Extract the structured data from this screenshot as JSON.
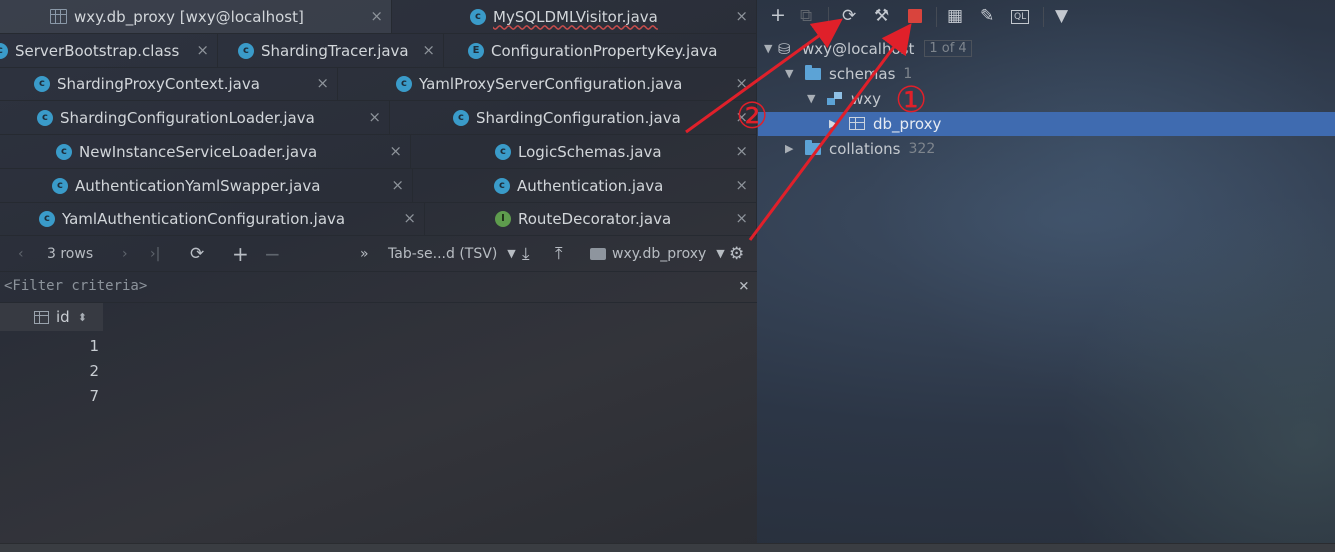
{
  "editor_tabs": {
    "rows": [
      [
        {
          "label": "wxy.db_proxy [wxy@localhost]",
          "icon": "table",
          "active": true
        },
        {
          "label": "MySQLDMLVisitor.java",
          "icon": "class",
          "squiggle": true
        }
      ],
      [
        {
          "label": "ServerBootstrap.class",
          "icon": "class"
        },
        {
          "label": "ShardingTracer.java",
          "icon": "class"
        },
        {
          "label": "ConfigurationPropertyKey.java",
          "icon": "enum"
        }
      ],
      [
        {
          "label": "ShardingProxyContext.java",
          "icon": "class"
        },
        {
          "label": "YamlProxyServerConfiguration.java",
          "icon": "class"
        }
      ],
      [
        {
          "label": "ShardingConfigurationLoader.java",
          "icon": "class"
        },
        {
          "label": "ShardingConfiguration.java",
          "icon": "class"
        }
      ],
      [
        {
          "label": "NewInstanceServiceLoader.java",
          "icon": "class"
        },
        {
          "label": "LogicSchemas.java",
          "icon": "class"
        }
      ],
      [
        {
          "label": "AuthenticationYamlSwapper.java",
          "icon": "class"
        },
        {
          "label": "Authentication.java",
          "icon": "class"
        }
      ],
      [
        {
          "label": "YamlAuthenticationConfiguration.java",
          "icon": "class"
        },
        {
          "label": "RouteDecorator.java",
          "icon": "interface"
        }
      ]
    ],
    "close_glyph": "×"
  },
  "result_toolbar": {
    "rows_label": "3 rows",
    "more_glyph": "»",
    "format_label": "Tab-se...d (TSV)",
    "datasource_label": "wxy.db_proxy"
  },
  "filter": {
    "placeholder": "<Filter criteria>"
  },
  "grid": {
    "columns": [
      "id"
    ],
    "sort_glyph": "⬍",
    "rows": [
      "1",
      "2",
      "7"
    ]
  },
  "db_tree": {
    "connection": {
      "label": "wxy@localhost",
      "badge": "1 of 4"
    },
    "schemas": {
      "label": "schemas",
      "count": "1"
    },
    "schema": {
      "label": "wxy"
    },
    "table": {
      "label": "db_proxy"
    },
    "collations": {
      "label": "collations",
      "count": "322"
    }
  },
  "annotations": {
    "mark_1": "①",
    "mark_2": "②",
    "color": "#e0202a"
  },
  "colors": {
    "selection": "#3f6bb0",
    "stop": "#d9443d",
    "class_icon": "#3a9bc9",
    "interface_icon": "#5e9c4d"
  }
}
